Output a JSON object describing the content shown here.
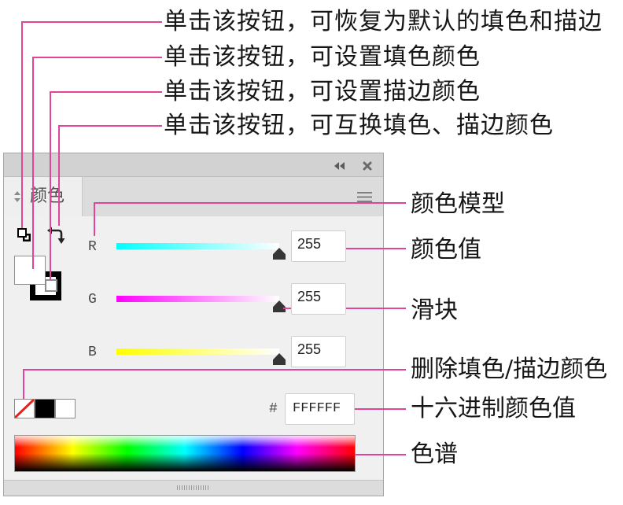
{
  "callouts": {
    "reset_default": "单击该按钮，可恢复为默认的填色和描边",
    "fill": "单击该按钮，可设置填色颜色",
    "stroke": "单击该按钮，可设置描边颜色",
    "swap": "单击该按钮，可互换填色、描边颜色",
    "color_model": "颜色模型",
    "color_value": "颜色值",
    "slider": "滑块",
    "remove_color": "删除填色/描边颜色",
    "hex_value": "十六进制颜色值",
    "spectrum": "色谱"
  },
  "colors": {
    "callout_line": "#e2449a",
    "none_slash": "#e3211f"
  },
  "panel": {
    "tab_title": "颜色",
    "icons": {
      "collapse": "collapse-icon",
      "close": "close-icon",
      "panel_menu": "menu-icon",
      "tab_cycle": "up-down-arrows-icon",
      "default_fill_stroke": "default-fill-stroke-icon",
      "swap_fill_stroke": "swap-arrow-icon",
      "none_swatch": "no-color-icon"
    },
    "fill_color": "#ffffff",
    "stroke_color": "#000000",
    "channels": [
      {
        "label": "R",
        "value": 255,
        "gradient": [
          "#00ffff",
          "#ffffff"
        ]
      },
      {
        "label": "G",
        "value": 255,
        "gradient": [
          "#ff00ff",
          "#ffffff"
        ]
      },
      {
        "label": "B",
        "value": 255,
        "gradient": [
          "#ffff00",
          "#ffffff"
        ]
      }
    ],
    "quick_swatches": {
      "black": "#000000",
      "white": "#ffffff"
    },
    "hex_label": "#",
    "hex_value": "FFFFFF"
  }
}
